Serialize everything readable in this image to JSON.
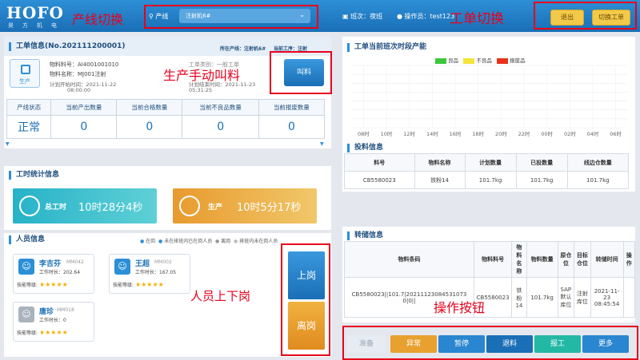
{
  "header": {
    "logo": "HOFO",
    "logo_sub": "昊方机电",
    "line_label": "产线",
    "line_value": "注射机6#",
    "shift_label": "班次：",
    "shift_value": "夜班",
    "operator_label": "操作员：",
    "operator_value": "test123",
    "exit_label": "退出",
    "switch_order_label": "切换工单"
  },
  "annotations": {
    "line_switch": "产线切换",
    "order_switch": "工单切换",
    "call_material": "生产手动叫料",
    "staff_onoff": "人员上下岗",
    "action_buttons": "操作按钮"
  },
  "order": {
    "title": "工单信息(No.202111200001)",
    "line_label": "所在产线：",
    "line_value": "注射机6#",
    "process_label": "当前工序：",
    "process_value": "注射",
    "status_badge": "生产",
    "material_no_label": "物料料号：",
    "material_no": "AI4001001010",
    "material_name_label": "物料名称：",
    "material_name": "MJ001注射",
    "plan_start_label": "计划开始时间：",
    "plan_start_date": "2021-11-22",
    "plan_start_time": "08:00:00",
    "category_label": "工单类别：",
    "category_value": "一般工单",
    "plan_end_label": "计划结束时间：",
    "plan_end_date": "2021-11-23",
    "plan_end_time": "05:31:25",
    "call_button": "叫料",
    "stats_headers": [
      "产线状态",
      "当前产出数量",
      "当前合格数量",
      "当前不良品数量",
      "当前报废数量"
    ],
    "stats_values": [
      "正常",
      "0",
      "0",
      "0",
      "0"
    ]
  },
  "worktime": {
    "title": "工时统计信息",
    "total_label": "总工时",
    "total_value": "10时28分4秒",
    "prod_label": "生产",
    "prod_value": "10时5分17秒"
  },
  "staff": {
    "title": "人员信息",
    "legend": [
      "在岗",
      "未在排班内已在岗人员",
      "离岗",
      "排班内未在岗人员"
    ],
    "worktime_label": "工作时长：",
    "skill_label": "技能等级:",
    "members": [
      {
        "name": "李吉芬",
        "code": "MM042",
        "hours": "202.64"
      },
      {
        "name": "王超",
        "code": "MM002",
        "hours": "167.05"
      },
      {
        "name": "唐珍",
        "code": "MM018",
        "hours": "0"
      }
    ],
    "on_duty_button": "上岗",
    "off_duty_button": "离岗"
  },
  "output": {
    "title": "工单当前班次时段产能",
    "legend": [
      {
        "label": "良品",
        "color": "#3cc83c"
      },
      {
        "label": "不良品",
        "color": "#f3e33a"
      },
      {
        "label": "报废品",
        "color": "#e8321c"
      }
    ],
    "chart_data": {
      "type": "bar",
      "categories": [
        "08时",
        "10时",
        "12时",
        "14时",
        "16时",
        "18时",
        "20时",
        "22时",
        "00时",
        "02时",
        "04时",
        "06时"
      ],
      "series": [
        {
          "name": "良品",
          "values": [
            0,
            0,
            0,
            0,
            0,
            0,
            0,
            0,
            0,
            0,
            0,
            0
          ]
        },
        {
          "name": "不良品",
          "values": [
            0,
            0,
            0,
            0,
            0,
            0,
            0,
            0,
            0,
            0,
            0,
            0
          ]
        },
        {
          "name": "报废品",
          "values": [
            0,
            0,
            0,
            0,
            0,
            0,
            0,
            0,
            0,
            0,
            0,
            0
          ]
        }
      ],
      "grid": true
    }
  },
  "feed": {
    "title": "投料信息",
    "headers": [
      "料号",
      "物料名称",
      "计划数量",
      "已投数量",
      "线边仓数量"
    ],
    "rows": [
      [
        "CB5580023",
        "铁粉14",
        "101.7kg",
        "101.7kg",
        "101.7kg"
      ]
    ]
  },
  "storage": {
    "title": "转储信息",
    "headers": [
      "物料条码",
      "物料料号",
      "物料名称",
      "物料数量",
      "原仓位",
      "目标仓位",
      "转储时间",
      "操作"
    ],
    "row": {
      "barcode": "CB5580023||101.7|20211123084531073 0|0||",
      "material_no": "CB5580023",
      "material_name": "铁粉14",
      "qty": "101.7kg",
      "src": "SAP默认库位",
      "dst": "注射库位",
      "time": "2021-11-23 08:45:54"
    }
  },
  "actions": {
    "ready": "准备",
    "abnormal": "异常",
    "pause": "暂停",
    "return": "退料",
    "report": "报工",
    "more": "更多"
  },
  "colors": {
    "primary": "#1a6fb6",
    "accent": "#2d8fd6",
    "annotation": "#e8001c",
    "gold": "#f3c94a",
    "orange": "#e89a2e",
    "teal": "#2ab5c4"
  }
}
